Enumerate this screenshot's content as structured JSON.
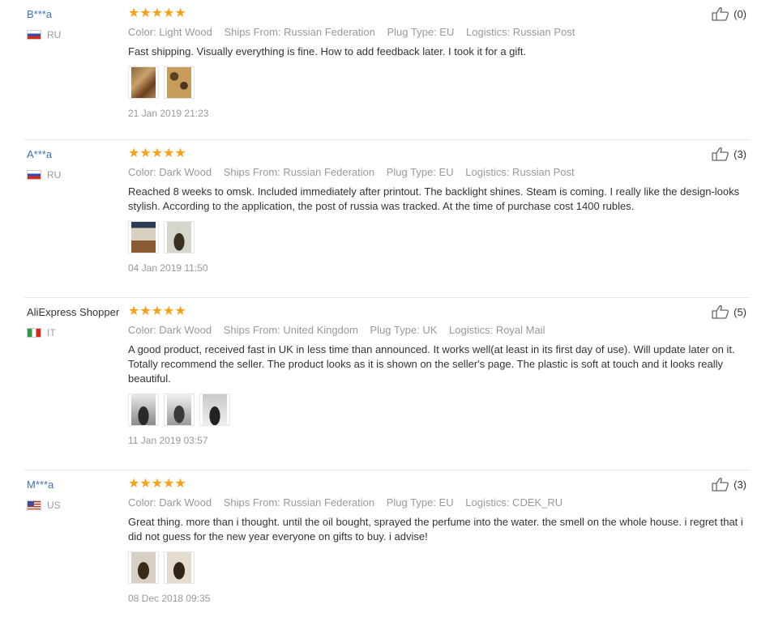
{
  "stars": "★★★★★",
  "reviews": [
    {
      "user": "B***a",
      "country": "RU",
      "color": "Color: Light Wood",
      "ships": "Ships From: Russian Federation",
      "plug": "Plug Type: EU",
      "logistics": "Logistics: Russian Post",
      "text": "Fast shipping. Visually everything is fine. How to add feedback later. I took it for a gift.",
      "date": "21 Jan 2019 21:23",
      "helpful": "(0)"
    },
    {
      "user": "A***a",
      "country": "RU",
      "color": "Color: Dark Wood",
      "ships": "Ships From: Russian Federation",
      "plug": "Plug Type: EU",
      "logistics": "Logistics: Russian Post",
      "text": "Reached 8 weeks to omsk. Included immediately after printout. The backlight shines. Steam is coming. I really like the design-looks stylish. According to the application, the post of russia was tracked. At the time of purchase cost 1400 rubles.",
      "date": "04 Jan 2019 11:50",
      "helpful": "(3)"
    },
    {
      "user": "AliExpress Shopper",
      "country": "IT",
      "color": "Color: Dark Wood",
      "ships": "Ships From: United Kingdom",
      "plug": "Plug Type: UK",
      "logistics": "Logistics: Royal Mail",
      "text": "A good product, received fast in UK in less time than announced. It works well(at least in its first day of use). Will update later on it. Totally recommend the seller. The product looks as it is shown on the seller's page. The plastic is soft at touch and it looks really beautiful.",
      "date": "11 Jan 2019 03:57",
      "helpful": "(5)"
    },
    {
      "user": "M***a",
      "country": "US",
      "color": "Color: Dark Wood",
      "ships": "Ships From: Russian Federation",
      "plug": "Plug Type: EU",
      "logistics": "Logistics: CDEK_RU",
      "text": "Great thing. more than i thought. until the oil bought, sprayed the perfume into the water. the smell on the whole house. i regret that i did not guess for the new year everyone on gifts to buy. i advise!",
      "date": "08 Dec 2018 09:35",
      "helpful": "(3)"
    }
  ]
}
